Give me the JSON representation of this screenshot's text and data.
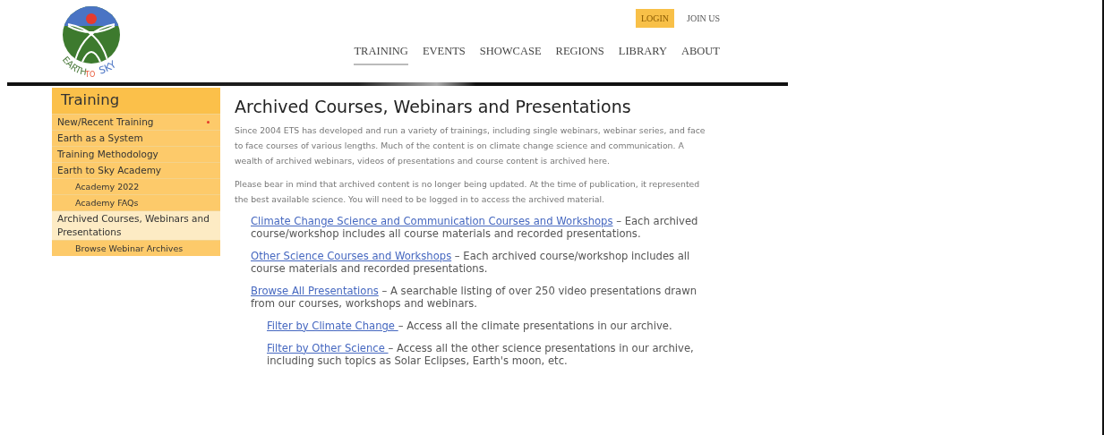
{
  "logo": {
    "words": [
      "EARTH",
      "TO",
      "SKY"
    ]
  },
  "top_links": [
    {
      "label": "LOGIN",
      "kind": "highlight"
    },
    {
      "label": "JOIN US",
      "kind": "plain"
    }
  ],
  "nav": [
    {
      "label": "TRAINING",
      "selected": true
    },
    {
      "label": "EVENTS",
      "selected": false
    },
    {
      "label": "SHOWCASE",
      "selected": false
    },
    {
      "label": "REGIONS",
      "selected": false
    },
    {
      "label": "LIBRARY",
      "selected": false
    },
    {
      "label": "ABOUT",
      "selected": false
    }
  ],
  "sidebar": {
    "title": "Training",
    "items": [
      {
        "label": "New/Recent Training",
        "selected": false,
        "flagged": true
      },
      {
        "label": "Earth as a System",
        "selected": false,
        "flagged": false
      },
      {
        "label": "Training Methodology",
        "selected": false,
        "flagged": false
      },
      {
        "label": "Earth to Sky Academy",
        "selected": false,
        "flagged": false,
        "children": [
          {
            "label": "Academy 2022",
            "selected": false,
            "flagged": false
          },
          {
            "label": "Academy FAQs",
            "selected": false,
            "flagged": false
          }
        ]
      },
      {
        "label": "Archived Courses, Webinars and Presentations",
        "selected": true,
        "flagged": false,
        "children": [
          {
            "label": "Browse Webinar Archives",
            "selected": false,
            "flagged": false
          }
        ]
      }
    ]
  },
  "main": {
    "title": "Archived Courses, Webinars and Presentations",
    "paragraphs": [
      "Since 2004 ETS has developed and run a variety of trainings, including single webinars, webinar series, and face to face courses of various lengths. Much of the content is on climate change science and communication. A wealth of archived webinars, videos of presentations and course content is archived here.",
      "Please bear in mind that archived content is no longer being updated. At the time of publication, it represented the best available science. You will need to be logged in to access the archived material."
    ],
    "links": [
      {
        "link": "Climate Change Science and Communication Courses and Workshops",
        "text": " – Each archived course/workshop includes all course materials and recorded presentations."
      },
      {
        "link": "Other Science Courses and Workshops",
        "text": " – Each archived course/workshop includes all course materials and recorded presentations."
      },
      {
        "link": "Browse All Presentations",
        "text": " – A searchable listing of over 250 video presentations drawn from our courses, workshops and webinars.",
        "children": [
          {
            "link": "Filter by Climate Change ",
            "text": "– Access all the climate presentations in our archive."
          },
          {
            "link": "Filter by Other Science ",
            "text": " – Access all the other science presentations in our archive, including such topics as Solar Eclipses, Earth's moon, etc."
          }
        ]
      }
    ]
  }
}
